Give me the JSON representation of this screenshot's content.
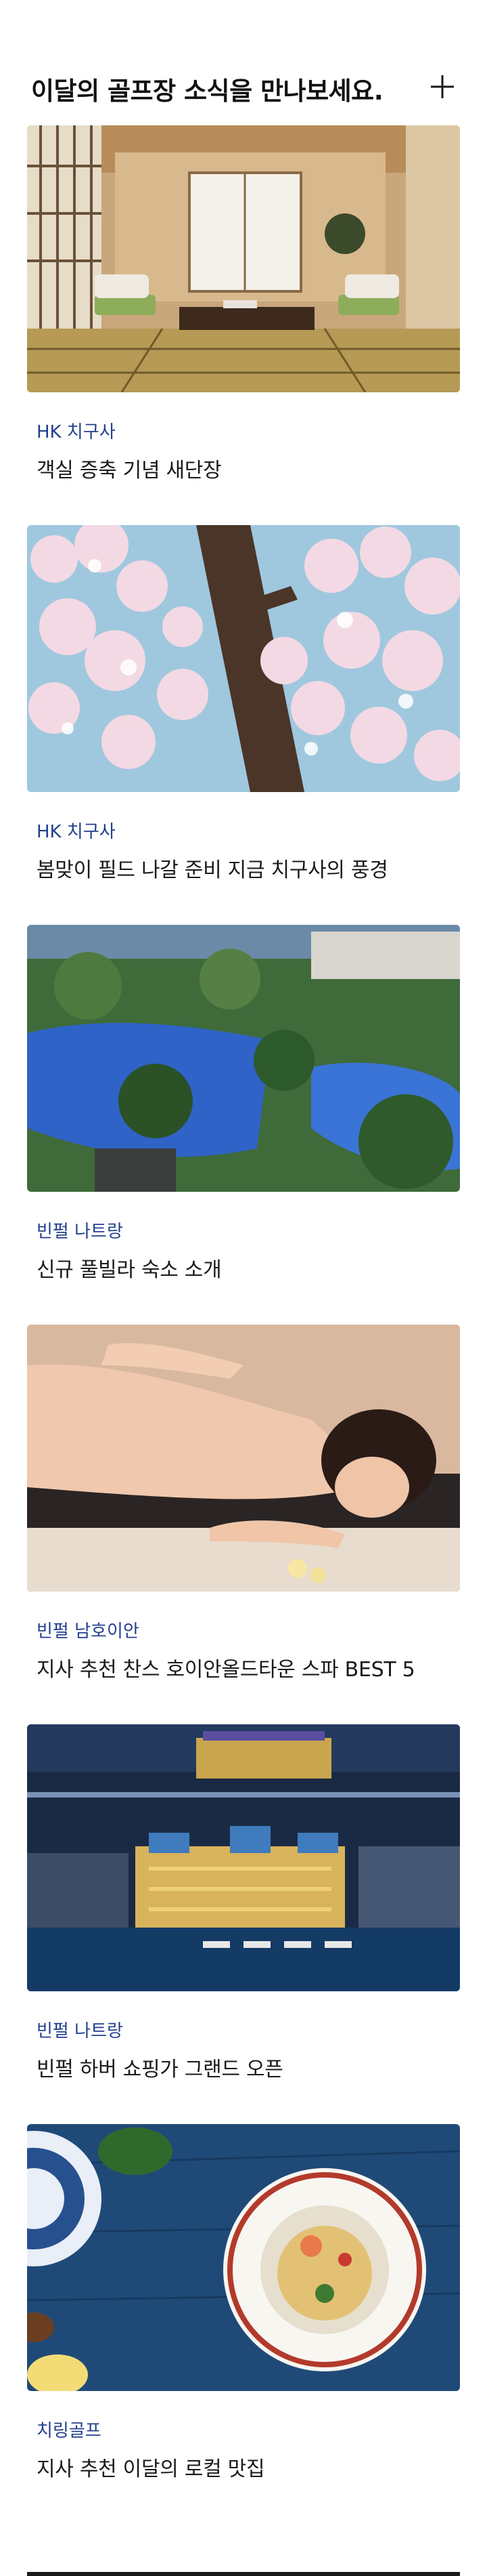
{
  "header": {
    "title": "이달의 골프장 소식을 만나보세요.",
    "add_icon": "plus-icon"
  },
  "cards": [
    {
      "category": "HK 치구사",
      "title": "객실 증축 기념 새단장",
      "image": "japanese-tatami-room-photo"
    },
    {
      "category": "HK 치구사",
      "title": "봄맞이 필드 나갈 준비 지금 치구사의 풍경",
      "image": "cherry-blossom-photo"
    },
    {
      "category": "빈펄 나트랑",
      "title": "신규 풀빌라 숙소 소개",
      "image": "resort-pool-aerial-photo"
    },
    {
      "category": "빈펄 남호이안",
      "title": "지사 추천 찬스 호이안올드타운 스파 BEST 5",
      "image": "spa-massage-photo"
    },
    {
      "category": "빈펄 나트랑",
      "title": "빈펄 하버 쇼핑가 그랜드 오픈",
      "image": "harbor-night-aerial-photo"
    },
    {
      "category": "치링골프",
      "title": "지사 추천 이달의 로컬 맛집",
      "image": "noodle-dish-photo"
    }
  ],
  "colors": {
    "category_text": "#23408e",
    "title_text": "#1a1a1a"
  }
}
